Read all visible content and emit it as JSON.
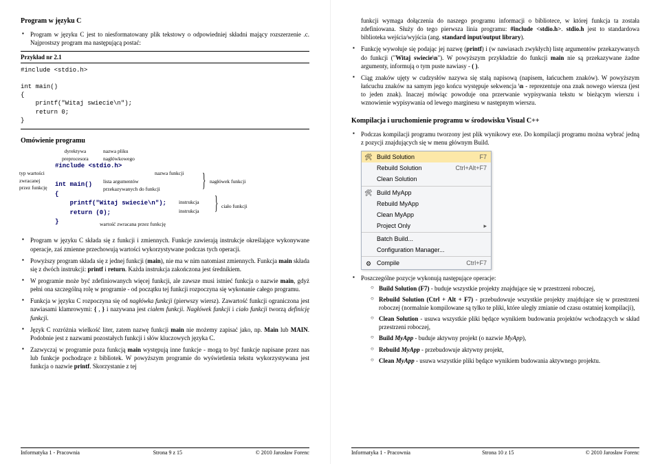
{
  "left": {
    "title": "Program w języku C",
    "intro": "Program w języku C jest to niesformatowany plik tekstowy o odpowiedniej składni mający rozszerzenie .c. Najprostszy program ma następującą postać:",
    "example_label": "Przykład nr 2.1",
    "code": "#include <stdio.h>\n\nint main()\n{\n    printf(\"Witaj swiecie\\n\");\n    return 0;\n}",
    "section2": "Omówienie programu",
    "lab_dyrektywa": "dyrektywa\npreprocesora",
    "lab_nazwa_pliku": "nazwa pliku\nnagłówkowego",
    "lab_typ": "typ wartości\nzwracanej\nprzez funkcję",
    "lab_nazwa_funkcji": "nazwa funkcji",
    "lab_lista": "lista argumentów\nprzekazywanych do funkcji",
    "lab_naglowek": "nagłówek funkcji",
    "lab_instrukcja1": "instrukcja",
    "lab_instrukcja2": "instrukcja",
    "lab_cialo": "ciało funkcji",
    "lab_wartosc": "wartość zwracana przez funkcję",
    "annot_code": "#include <stdio.h>\n\nint main()\n{\n    printf(\"Witaj swiecie\\n\");\n    return (0);\n}",
    "b1": "Program w języku C składa się z funkcji i zmiennych. Funkcje zawierają instrukcje określające wykonywane operacje, zaś zmienne przechowują wartości wykorzystywane podczas tych operacji.",
    "b2_a": "Powyższy program składa się z jednej funkcji (",
    "b2_b": "), nie ma w nim natomiast zmiennych. Funkcja ",
    "b2_c": " składa się z dwóch instrukcji: ",
    "b2_d": ". Każda instrukcja zakończona jest średnikiem.",
    "b3_a": "W programie może być zdefiniowanych więcej funkcji, ale zawsze musi istnieć funkcja o nazwie ",
    "b3_b": ", gdyż pełni ona szczególną rolę w programie - od początku tej funkcji rozpoczyna się wykonanie całego programu.",
    "b4_a": "Funkcja w języku C rozpoczyna się od ",
    "b4_na": "nagłówka funkcji",
    "b4_b": " (pierwszy wiersz). Zawartość funkcji ograniczona jest nawiasami klamrowymi: ",
    "b4_c": " i nazywana jest ",
    "b4_ci": "ciałem funkcji. Nagłówek funkcji",
    "b4_d": " i ",
    "b4_cf": "ciało funkcji",
    "b4_e": " tworzą ",
    "b4_df": "definicję funkcji.",
    "b5_a": "Język C rozróżnia wielkość liter, zatem nazwę funkcji ",
    "b5_b": " nie możemy zapisać jako, np. ",
    "b5_c": " lub ",
    "b5_d": ". Podobnie jest z nazwami pozostałych funkcji i słów kluczowych języka C.",
    "b6_a": "Zazwyczaj w programie poza funkcją ",
    "b6_b": " występują inne funkcje - mogą to być funkcje napisane przez nas lub funkcje pochodzące z bibliotek. W powyższym programie do wyświetlenia tekstu wykorzystywana jest funkcja o nazwie ",
    "b6_c": ". Skorzystanie z tej",
    "foot_l": "Informatyka 1 - Pracownia",
    "foot_c": "Strona 9 z 15",
    "foot_r": "© 2010 Jarosław Forenc"
  },
  "right": {
    "r1_a": "funkcji wymaga dołączenia do naszego programu informacji o bibliotece, w której funkcja ta została zdefiniowana. Służy do tego pierwsza linia programu: ",
    "r1_inc": "#include <stdio.h>",
    "r1_b": ". ",
    "r1_st": "stdio.h",
    "r1_c": " jest to standardowa biblioteka wejścia/wyjścia (ang. ",
    "r1_sio": "standard input/output library",
    "r1_d": ").",
    "r2_a": "Funkcję wywołuje się podając jej nazwę (",
    "r2_b": ") i (w nawiasach zwykłych) listę argumentów przekazywanych do funkcji (\"",
    "r2_c": "\"). W powyższym przykładzie do funkcji ",
    "r2_d": " nie są przekazywane żadne argumenty, informują o tym puste nawiasy - ",
    "r2_e": ".",
    "r3_a": "Ciąg znaków ujęty w cudzysłów nazywa się stałą napisową (napisem, łańcuchem znaków). W powyższym łańcuchu znaków na samym jego końcu występuje sekwencja ",
    "r3_b": " - reprezentuje ona znak nowego wiersza (jest to jeden znak). Inaczej mówiąc powoduje ona przerwanie wypisywania tekstu w bieżącym wierszu i wznowienie wypisywania od lewego marginesu w następnym wierszu.",
    "section": "Kompilacja i uruchomienie programu w środowisku Visual C++",
    "rb1": "Podczas kompilacji programu tworzony jest plik wynikowy exe. Do kompilacji programu można wybrać jedną z pozycji znajdujących się w menu głównym Build.",
    "menu": {
      "i0": {
        "t": "Build Solution",
        "s": "F7"
      },
      "i1": {
        "t": "Rebuild Solution",
        "s": "Ctrl+Alt+F7"
      },
      "i2": {
        "t": "Clean Solution",
        "s": ""
      },
      "i3": {
        "t": "Build MyApp",
        "s": ""
      },
      "i4": {
        "t": "Rebuild MyApp",
        "s": ""
      },
      "i5": {
        "t": "Clean MyApp",
        "s": ""
      },
      "i6": {
        "t": "Project Only",
        "s": "▸"
      },
      "i7": {
        "t": "Batch Build...",
        "s": ""
      },
      "i8": {
        "t": "Configuration Manager...",
        "s": ""
      },
      "i9": {
        "t": "Compile",
        "s": "Ctrl+F7"
      }
    },
    "rb2": "Poszczególne pozycje wykonują następujące operacje:",
    "o1_a": "Build Solution (F7)",
    "o1_b": " - buduje wszystkie projekty znajdujące się w przestrzeni roboczej,",
    "o2_a": "Rebuild Solution (Ctrl + Alt + F7)",
    "o2_b": " - przebudowuje wszystkie projekty znajdujące się w przestrzeni roboczej (normalnie kompilowane są tylko te pliki, które uległy zmianie od czasu ostatniej kompilacji),",
    "o3_a": "Clean Solution",
    "o3_b": " - usuwa wszystkie pliki będące wynikiem budowania projektów wchodzących w skład przestrzeni roboczej,",
    "o4_a": "Build ",
    "o4_m": "MyApp",
    "o4_b": " - buduje aktywny projekt (o nazwie ",
    "o4_c": "),",
    "o5_a": "Rebuild ",
    "o5_b": " - przebudowuje aktywny projekt,",
    "o6_a": "Clean ",
    "o6_b": " - usuwa wszystkie pliki będące wynikiem budowania aktywnego projektu.",
    "foot_c": "Strona 10 z 15"
  }
}
